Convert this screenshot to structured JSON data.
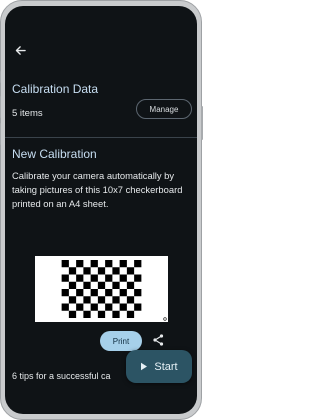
{
  "header": {
    "back_icon": "arrow-left-icon"
  },
  "calibration_data": {
    "title": "Calibration Data",
    "count": "5 items",
    "manage_label": "Manage"
  },
  "new_calibration": {
    "title": "New Calibration",
    "description": "Calibrate your camera automatically by taking pictures of this 10x7 checkerboard printed on an A4 sheet.",
    "checkerboard": {
      "columns": 10,
      "rows": 7
    },
    "print_label": "Print",
    "share_icon": "share-icon"
  },
  "tips_text": "6 tips for a successful ca",
  "fab": {
    "start_label": "Start",
    "icon": "play-icon"
  },
  "colors": {
    "background": "#0f1316",
    "section_title": "#c7def2",
    "print_button": "#a6d0ea",
    "start_button": "#2c5464"
  }
}
